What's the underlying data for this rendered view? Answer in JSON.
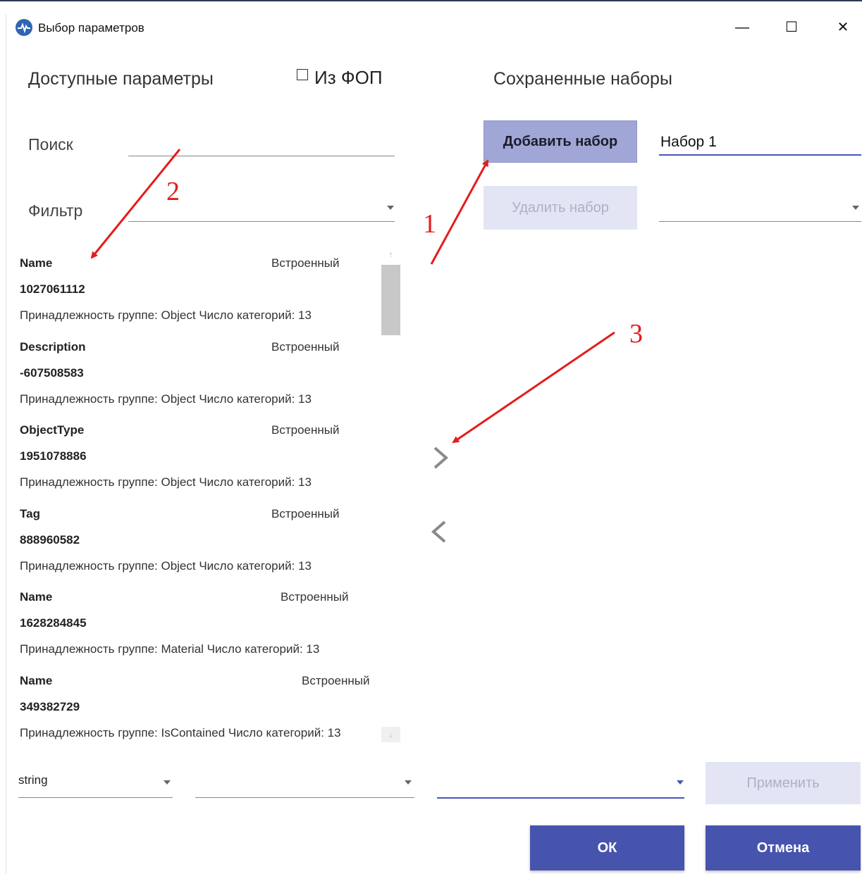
{
  "window": {
    "title": "Выбор параметров",
    "minimize": "—",
    "maximize": "☐",
    "close": "✕"
  },
  "left": {
    "heading": "Доступные параметры",
    "from_fop_label": "Из ФОП",
    "from_fop_checked": false,
    "search_label": "Поиск",
    "search_value": "",
    "filter_label": "Фильтр",
    "filter_value": ""
  },
  "right": {
    "heading": "Сохраненные наборы",
    "add_button": "Добавить набор",
    "delete_button": "Удалить набор",
    "set_name_value": "Набор 1",
    "set_select_value": ""
  },
  "parameters": [
    {
      "name": "Name",
      "type": "Встроенный",
      "id": "1027061112",
      "meta": "Принадлежность группе: Object   Число категорий: 13"
    },
    {
      "name": "Description",
      "type": "Встроенный",
      "id": "-607508583",
      "meta": "Принадлежность группе: Object   Число категорий: 13"
    },
    {
      "name": "ObjectType",
      "type": "Встроенный",
      "id": "1951078886",
      "meta": "Принадлежность группе: Object   Число категорий: 13"
    },
    {
      "name": "Tag",
      "type": "Встроенный",
      "id": "888960582",
      "meta": "Принадлежность группе: Object   Число категорий: 13"
    },
    {
      "name": "Name",
      "type": "Встроенный",
      "id": "1628284845",
      "meta": "Принадлежность группе: Material   Число категорий: 13"
    },
    {
      "name": "Name",
      "type": "Встроенный",
      "id": "349382729",
      "meta": "Принадлежность группе: IsContained   Число категорий: 13"
    }
  ],
  "scrollbar": {
    "up": "↑",
    "down": "↓"
  },
  "bottom": {
    "type_select": "string",
    "select_2": "",
    "select_3": "",
    "apply_button": "Применить",
    "ok_button": "ОК",
    "cancel_button": "Отмена"
  },
  "annotations": {
    "a1": "1",
    "a2": "2",
    "a3": "3"
  },
  "colors": {
    "primary": "#4654ae",
    "accent_light": "#a0a6d6",
    "disabled": "#e3e5f4",
    "annotation": "#e41c1c"
  }
}
